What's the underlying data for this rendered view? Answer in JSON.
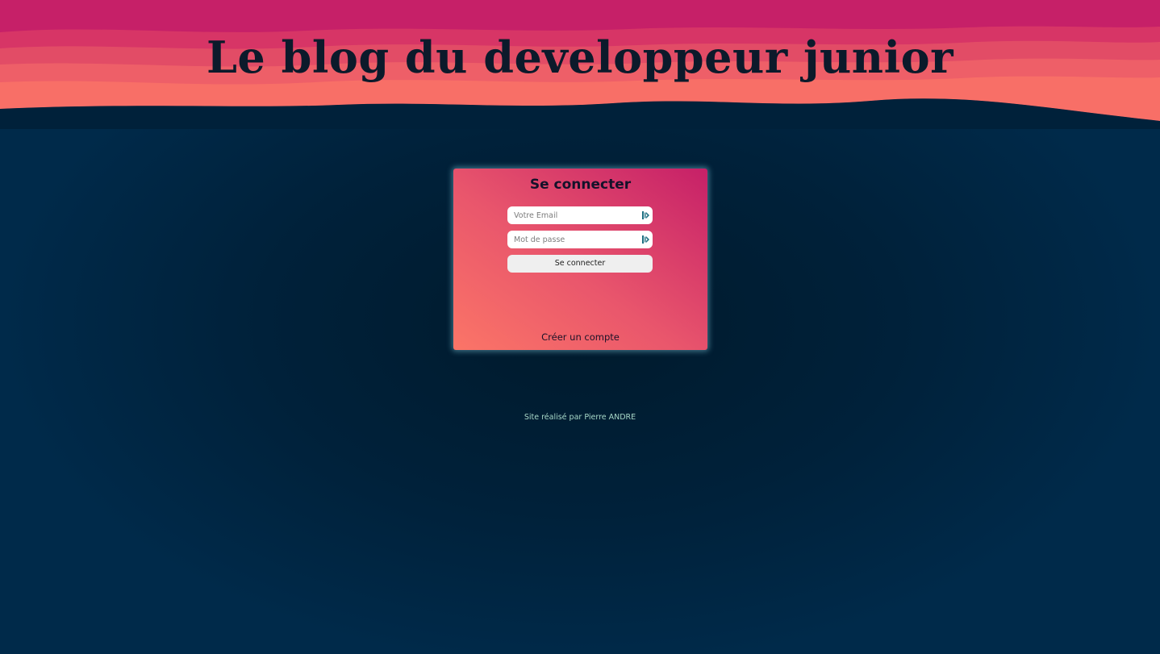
{
  "header": {
    "title": "Le blog du developpeur junior"
  },
  "login": {
    "title": "Se connecter",
    "email_placeholder": "Votre Email",
    "password_placeholder": "Mot de passe",
    "submit_label": "Se connecter",
    "create_account_label": "Créer un compte"
  },
  "footer": {
    "credit": "Site réalisé par Pierre ANDRE"
  },
  "colors": {
    "background": "#00213a",
    "wave_top": "#c62068",
    "wave_bottom": "#fb7567",
    "title_text": "#0c1a2b",
    "footer_text": "#a8d8c8"
  },
  "icons": {
    "field_icon": "password-manager-icon"
  }
}
